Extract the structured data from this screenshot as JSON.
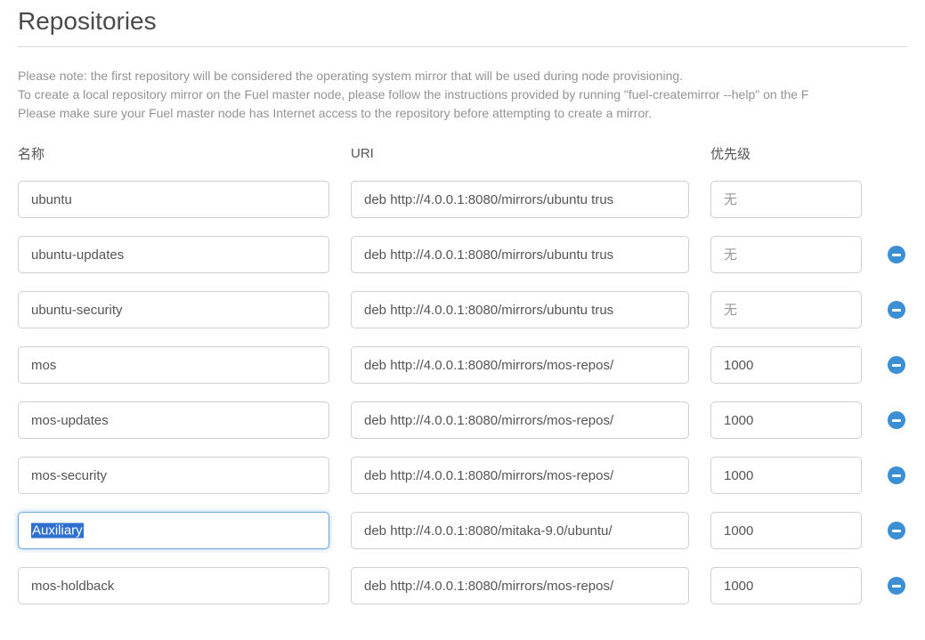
{
  "title": "Repositories",
  "note_lines": [
    "Please note: the first repository will be considered the operating system mirror that will be used during node provisioning.",
    "To create a local repository mirror on the Fuel master node, please follow the instructions provided by running \"fuel-createmirror --help\" on the F",
    "Please make sure your Fuel master node has Internet access to the repository before attempting to create a mirror."
  ],
  "headers": {
    "name": "名称",
    "uri": "URI",
    "priority": "优先级"
  },
  "priority_placeholder": "无",
  "rows": [
    {
      "name": "ubuntu",
      "uri": "deb http://4.0.0.1:8080/mirrors/ubuntu trus",
      "priority": "",
      "removable": false,
      "focused": false
    },
    {
      "name": "ubuntu-updates",
      "uri": "deb http://4.0.0.1:8080/mirrors/ubuntu trus",
      "priority": "",
      "removable": true,
      "focused": false
    },
    {
      "name": "ubuntu-security",
      "uri": "deb http://4.0.0.1:8080/mirrors/ubuntu trus",
      "priority": "",
      "removable": true,
      "focused": false
    },
    {
      "name": "mos",
      "uri": "deb http://4.0.0.1:8080/mirrors/mos-repos/",
      "priority": "1000",
      "removable": true,
      "focused": false
    },
    {
      "name": "mos-updates",
      "uri": "deb http://4.0.0.1:8080/mirrors/mos-repos/",
      "priority": "1000",
      "removable": true,
      "focused": false
    },
    {
      "name": "mos-security",
      "uri": "deb http://4.0.0.1:8080/mirrors/mos-repos/",
      "priority": "1000",
      "removable": true,
      "focused": false
    },
    {
      "name": "Auxiliary",
      "uri": "deb http://4.0.0.1:8080/mitaka-9.0/ubuntu/",
      "priority": "1000",
      "removable": true,
      "focused": true
    },
    {
      "name": "mos-holdback",
      "uri": "deb http://4.0.0.1:8080/mirrors/mos-repos/",
      "priority": "1000",
      "removable": true,
      "focused": false
    }
  ]
}
